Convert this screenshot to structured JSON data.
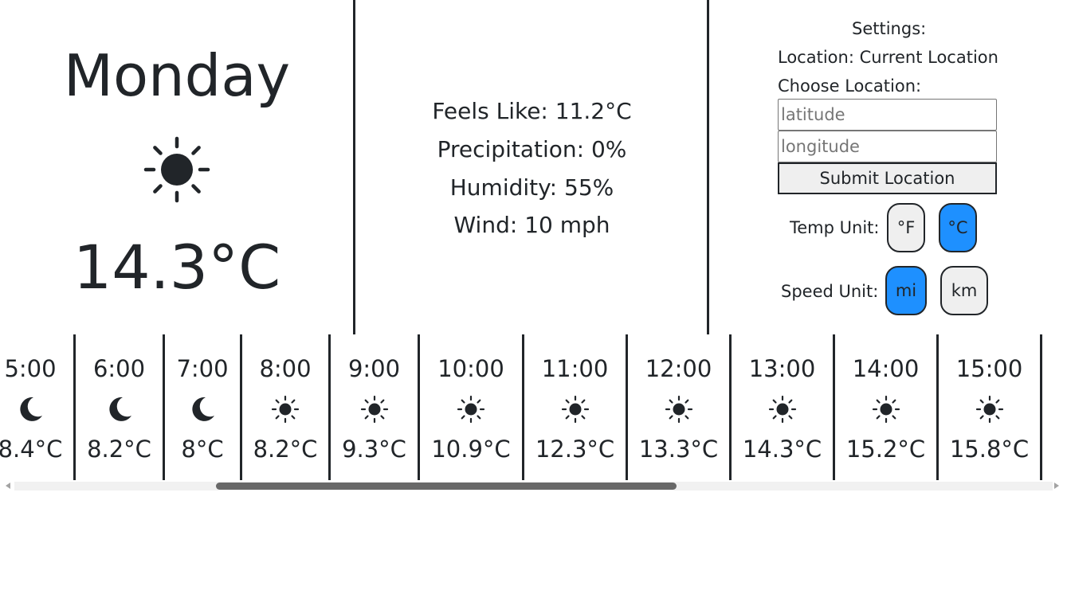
{
  "current": {
    "day": "Monday",
    "icon": "sun-icon",
    "temperature": "14.3°C"
  },
  "details": {
    "feels_like": "Feels Like: 11.2°C",
    "precipitation": "Precipitation: 0%",
    "humidity": "Humidity: 55%",
    "wind": "Wind: 10 mph"
  },
  "settings": {
    "title": "Settings:",
    "location": "Location: Current Location",
    "choose_location": "Choose Location:",
    "latitude_placeholder": "latitude",
    "latitude_value": "",
    "longitude_placeholder": "longitude",
    "longitude_value": "",
    "submit_label": "Submit Location",
    "temp_unit_label": "Temp Unit:",
    "temp_units": [
      "°F",
      "°C"
    ],
    "temp_unit_selected": "°C",
    "speed_unit_label": "Speed Unit:",
    "speed_units": [
      "mi",
      "km"
    ],
    "speed_unit_selected": "mi"
  },
  "colors": {
    "active_button": "#1e90ff",
    "inactive_button": "#efefef",
    "text": "#212529"
  },
  "hourly": [
    {
      "time": "5:00",
      "icon": "moon-icon",
      "temp": "8.4°C"
    },
    {
      "time": "6:00",
      "icon": "moon-icon",
      "temp": "8.2°C"
    },
    {
      "time": "7:00",
      "icon": "moon-icon",
      "temp": "8°C"
    },
    {
      "time": "8:00",
      "icon": "sun-icon",
      "temp": "8.2°C"
    },
    {
      "time": "9:00",
      "icon": "sun-icon",
      "temp": "9.3°C"
    },
    {
      "time": "10:00",
      "icon": "sun-icon",
      "temp": "10.9°C"
    },
    {
      "time": "11:00",
      "icon": "sun-icon",
      "temp": "12.3°C"
    },
    {
      "time": "12:00",
      "icon": "sun-icon",
      "temp": "13.3°C"
    },
    {
      "time": "13:00",
      "icon": "sun-icon",
      "temp": "14.3°C"
    },
    {
      "time": "14:00",
      "icon": "sun-icon",
      "temp": "15.2°C"
    },
    {
      "time": "15:00",
      "icon": "sun-icon",
      "temp": "15.8°C"
    }
  ]
}
